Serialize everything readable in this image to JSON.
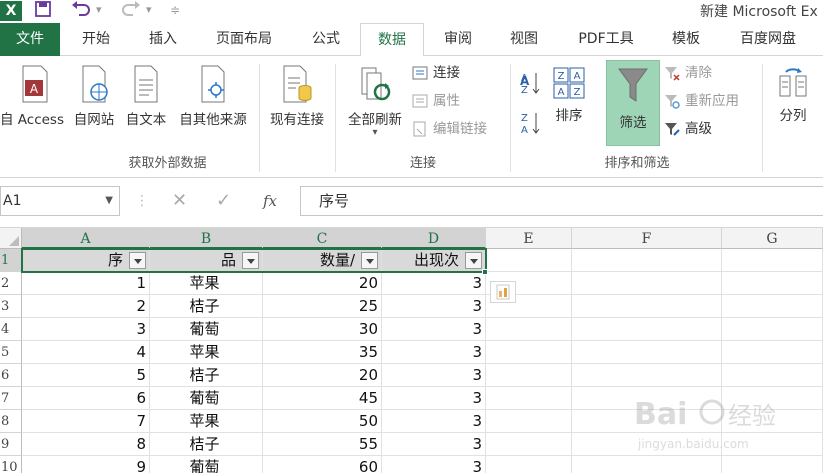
{
  "window": {
    "title": "新建 Microsoft Ex",
    "app_icon": "X"
  },
  "ribbon_tabs": [
    {
      "label": "文件"
    },
    {
      "label": "开始"
    },
    {
      "label": "插入"
    },
    {
      "label": "页面布局"
    },
    {
      "label": "公式"
    },
    {
      "label": "数据"
    },
    {
      "label": "审阅"
    },
    {
      "label": "视图"
    },
    {
      "label": "PDF工具"
    },
    {
      "label": "模板"
    },
    {
      "label": "百度网盘"
    }
  ],
  "ribbon": {
    "get_external": {
      "access": "自 Access",
      "web": "自网站",
      "text": "自文本",
      "other": "自其他来源",
      "existing": "现有连接",
      "group_label": "获取外部数据"
    },
    "connections": {
      "refresh_all": "全部刷新",
      "connections": "连接",
      "properties": "属性",
      "edit_links": "编辑链接",
      "group_label": "连接"
    },
    "sort_filter": {
      "sort": "排序",
      "filter": "筛选",
      "clear": "清除",
      "reapply": "重新应用",
      "advanced": "高级",
      "group_label": "排序和筛选"
    },
    "data_tools": {
      "split": "分列"
    }
  },
  "formula_bar": {
    "name_box": "A1",
    "formula": "序号"
  },
  "columns": [
    "A",
    "B",
    "C",
    "D",
    "E",
    "F",
    "G"
  ],
  "rows": [
    "1",
    "2",
    "3",
    "4",
    "5",
    "6",
    "7",
    "8",
    "9",
    "10"
  ],
  "table": {
    "headers": [
      "序",
      "品",
      "数量/",
      "出现次"
    ],
    "data": [
      [
        "1",
        "苹果",
        "20",
        "3"
      ],
      [
        "2",
        "桔子",
        "25",
        "3"
      ],
      [
        "3",
        "葡萄",
        "30",
        "3"
      ],
      [
        "4",
        "苹果",
        "35",
        "3"
      ],
      [
        "5",
        "桔子",
        "20",
        "3"
      ],
      [
        "6",
        "葡萄",
        "45",
        "3"
      ],
      [
        "7",
        "苹果",
        "50",
        "3"
      ],
      [
        "8",
        "桔子",
        "55",
        "3"
      ],
      [
        "9",
        "葡萄",
        "60",
        "3"
      ]
    ]
  },
  "watermark": {
    "brand": "Baidu经验",
    "url": "jingyan.baidu.com"
  },
  "colors": {
    "accent": "#217346",
    "header_fill": "#d9d9d9",
    "filter_active": "#9fd5b7"
  }
}
